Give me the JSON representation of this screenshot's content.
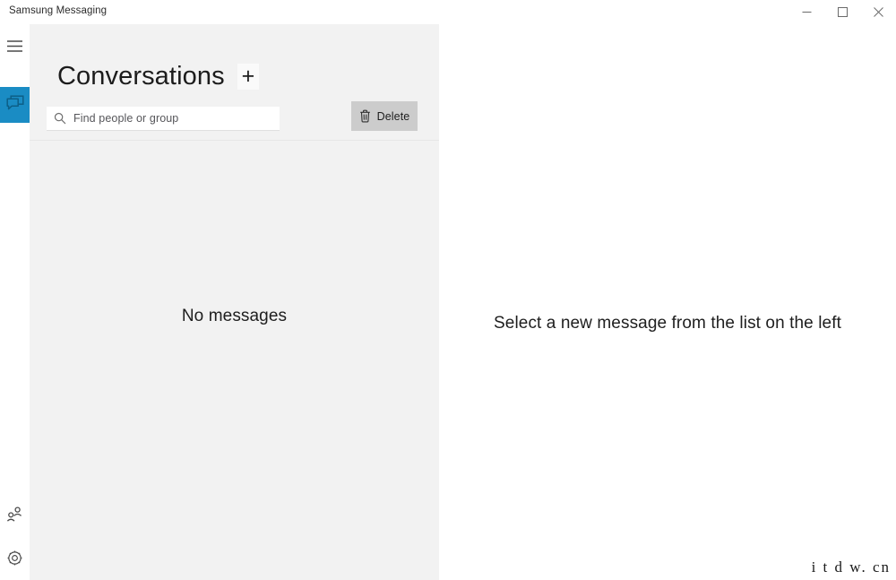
{
  "window": {
    "title": "Samsung Messaging",
    "controls": {
      "minimize": "minimize-button",
      "maximize": "maximize-button",
      "close": "close-button"
    }
  },
  "rail": {
    "menu_icon": "hamburger-menu-icon",
    "conversations_icon": "conversation-bubble-icon",
    "people_icon": "people-icon",
    "settings_icon": "gear-icon",
    "active_accent": "#1a8cc4"
  },
  "left_panel": {
    "heading": "Conversations",
    "new_conversation_label": "+",
    "search": {
      "placeholder": "Find people or group",
      "value": "",
      "icon": "search-icon"
    },
    "delete_button": {
      "label": "Delete",
      "icon": "trash-icon"
    },
    "empty_state": "No messages",
    "background": "#f2f2f2"
  },
  "right_panel": {
    "empty_state": "Select a new message from the list on the left",
    "background": "#ffffff"
  },
  "watermark": {
    "text": "i t d w. cn"
  }
}
